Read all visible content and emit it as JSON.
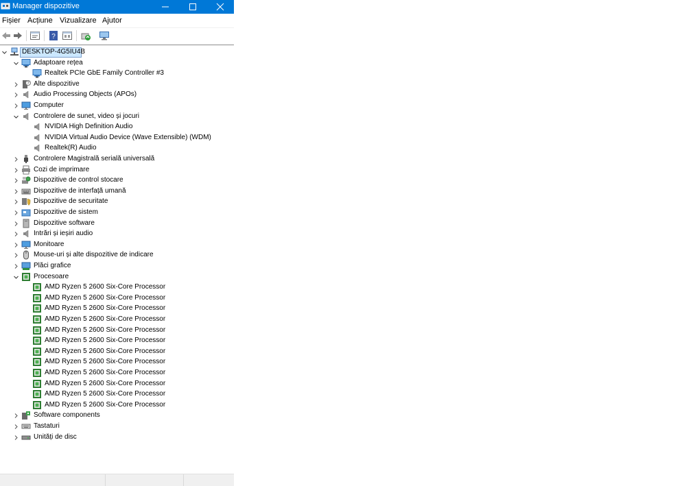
{
  "window": {
    "title": "Manager dispozitive",
    "app_icon": "device-manager-icon",
    "accent": "#0078d7"
  },
  "menu": [
    "Fișier",
    "Acțiune",
    "Vizualizare",
    "Ajutor"
  ],
  "toolbar": [
    "back-icon",
    "forward-icon",
    "properties-icon",
    "help-icon",
    "details-icon",
    "update-driver-icon",
    "scan-hardware-icon"
  ],
  "tree": {
    "root": {
      "label": "DESKTOP-4G5IU4B",
      "icon": "computer-network-icon",
      "expanded": true,
      "selected": true
    },
    "categories": [
      {
        "label": "Adaptoare rețea",
        "icon": "network-adapter-icon",
        "expanded": true,
        "children": [
          {
            "label": "Realtek PCIe GbE Family Controller #3",
            "icon": "network-adapter-icon"
          }
        ]
      },
      {
        "label": "Alte dispozitive",
        "icon": "unknown-device-icon",
        "expanded": false
      },
      {
        "label": "Audio Processing Objects (APOs)",
        "icon": "speaker-icon",
        "expanded": false
      },
      {
        "label": "Computer",
        "icon": "monitor-icon",
        "expanded": false
      },
      {
        "label": "Controlere de sunet, video și jocuri",
        "icon": "speaker-icon",
        "expanded": true,
        "children": [
          {
            "label": "NVIDIA High Definition Audio",
            "icon": "speaker-icon"
          },
          {
            "label": "NVIDIA Virtual Audio Device (Wave Extensible) (WDM)",
            "icon": "speaker-icon"
          },
          {
            "label": "Realtek(R) Audio",
            "icon": "speaker-icon"
          }
        ]
      },
      {
        "label": "Controlere Magistrală serială universală",
        "icon": "usb-icon",
        "expanded": false
      },
      {
        "label": "Cozi de imprimare",
        "icon": "printer-icon",
        "expanded": false
      },
      {
        "label": "Dispozitive de control stocare",
        "icon": "storage-controller-icon",
        "expanded": false
      },
      {
        "label": "Dispozitive de interfață umană",
        "icon": "hid-icon",
        "expanded": false
      },
      {
        "label": "Dispozitive de securitate",
        "icon": "security-device-icon",
        "expanded": false
      },
      {
        "label": "Dispozitive de sistem",
        "icon": "system-device-icon",
        "expanded": false
      },
      {
        "label": "Dispozitive software",
        "icon": "software-device-icon",
        "expanded": false
      },
      {
        "label": "Intrări și ieșiri audio",
        "icon": "speaker-icon",
        "expanded": false
      },
      {
        "label": "Monitoare",
        "icon": "monitor-icon",
        "expanded": false
      },
      {
        "label": "Mouse-uri și alte dispozitive de indicare",
        "icon": "mouse-icon",
        "expanded": false
      },
      {
        "label": "Plăci grafice",
        "icon": "display-adapter-icon",
        "expanded": false
      },
      {
        "label": "Procesoare",
        "icon": "processor-icon",
        "expanded": true,
        "children": [
          {
            "label": "AMD Ryzen 5 2600 Six-Core Processor",
            "icon": "processor-icon"
          },
          {
            "label": "AMD Ryzen 5 2600 Six-Core Processor",
            "icon": "processor-icon"
          },
          {
            "label": "AMD Ryzen 5 2600 Six-Core Processor",
            "icon": "processor-icon"
          },
          {
            "label": "AMD Ryzen 5 2600 Six-Core Processor",
            "icon": "processor-icon"
          },
          {
            "label": "AMD Ryzen 5 2600 Six-Core Processor",
            "icon": "processor-icon"
          },
          {
            "label": "AMD Ryzen 5 2600 Six-Core Processor",
            "icon": "processor-icon"
          },
          {
            "label": "AMD Ryzen 5 2600 Six-Core Processor",
            "icon": "processor-icon"
          },
          {
            "label": "AMD Ryzen 5 2600 Six-Core Processor",
            "icon": "processor-icon"
          },
          {
            "label": "AMD Ryzen 5 2600 Six-Core Processor",
            "icon": "processor-icon"
          },
          {
            "label": "AMD Ryzen 5 2600 Six-Core Processor",
            "icon": "processor-icon"
          },
          {
            "label": "AMD Ryzen 5 2600 Six-Core Processor",
            "icon": "processor-icon"
          },
          {
            "label": "AMD Ryzen 5 2600 Six-Core Processor",
            "icon": "processor-icon"
          }
        ]
      },
      {
        "label": "Software components",
        "icon": "software-component-icon",
        "expanded": false
      },
      {
        "label": "Tastaturi",
        "icon": "keyboard-icon",
        "expanded": false
      },
      {
        "label": "Unități de disc",
        "icon": "disk-drive-icon",
        "expanded": false
      }
    ]
  }
}
